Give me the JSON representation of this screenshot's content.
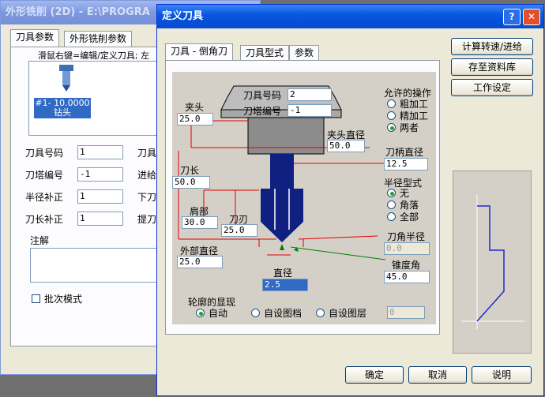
{
  "bg_window": {
    "title": "外形铣削 (2D) - E:\\PROGRA",
    "tabs": [
      "刀具参数",
      "外形铣削参数"
    ],
    "hint": "滑鼠右键=编辑/定义刀具; 左",
    "tool_item": {
      "line1": "#1- 10.0000",
      "line2": "钻头"
    },
    "fields": [
      {
        "label": "刀具号码",
        "value": "1"
      },
      {
        "label": "刀塔编号",
        "value": "-1"
      },
      {
        "label": "半径补正",
        "value": "1"
      },
      {
        "label": "刀长补正",
        "value": "1"
      }
    ],
    "right_labels": [
      "刀具",
      "进给",
      "下刀",
      "提刀"
    ],
    "notes_label": "注解",
    "batch_label": "批次模式"
  },
  "dialog": {
    "title": "定义刀具",
    "tabs": [
      "刀具 - 倒角刀",
      "刀具型式",
      "参数"
    ],
    "buttons": {
      "calc": "计算转速/进给",
      "save_lib": "存至资料库",
      "work_settings": "工作设定",
      "ok": "确定",
      "cancel": "取消",
      "help": "说明"
    },
    "diagram": {
      "tool_number_label": "刀具号码",
      "tool_number_value": "2",
      "turret_label": "刀塔编号",
      "turret_value": "-1",
      "chuck_label": "夹头",
      "chuck_value": "25.0",
      "chuck_dia_label": "夹头直径",
      "chuck_dia_value": "50.0",
      "length_label": "刀长",
      "length_value": "50.0",
      "shoulder_label": "肩部",
      "shoulder_value": "30.0",
      "flute_label": "刀刃",
      "flute_value": "25.0",
      "outer_dia_label": "外部直径",
      "outer_dia_value": "25.0",
      "dia_label": "直径",
      "dia_value": "2.5",
      "shank_dia_label": "刀柄直径",
      "shank_dia_value": "12.5",
      "corner_radius_label": "刀角半径",
      "corner_radius_value": "0.0",
      "taper_label": "锥度角",
      "taper_value": "45.0"
    },
    "ops": {
      "title": "允许的操作",
      "options": [
        "粗加工",
        "精加工",
        "两者"
      ],
      "selected": 2
    },
    "radius": {
      "title": "半径型式",
      "options": [
        "无",
        "角落",
        "全部"
      ],
      "selected": 0
    },
    "profile": {
      "title": "轮廓的显现",
      "options": [
        "自动",
        "自设图档",
        "自设图层"
      ],
      "selected": 0,
      "value": "0"
    }
  }
}
